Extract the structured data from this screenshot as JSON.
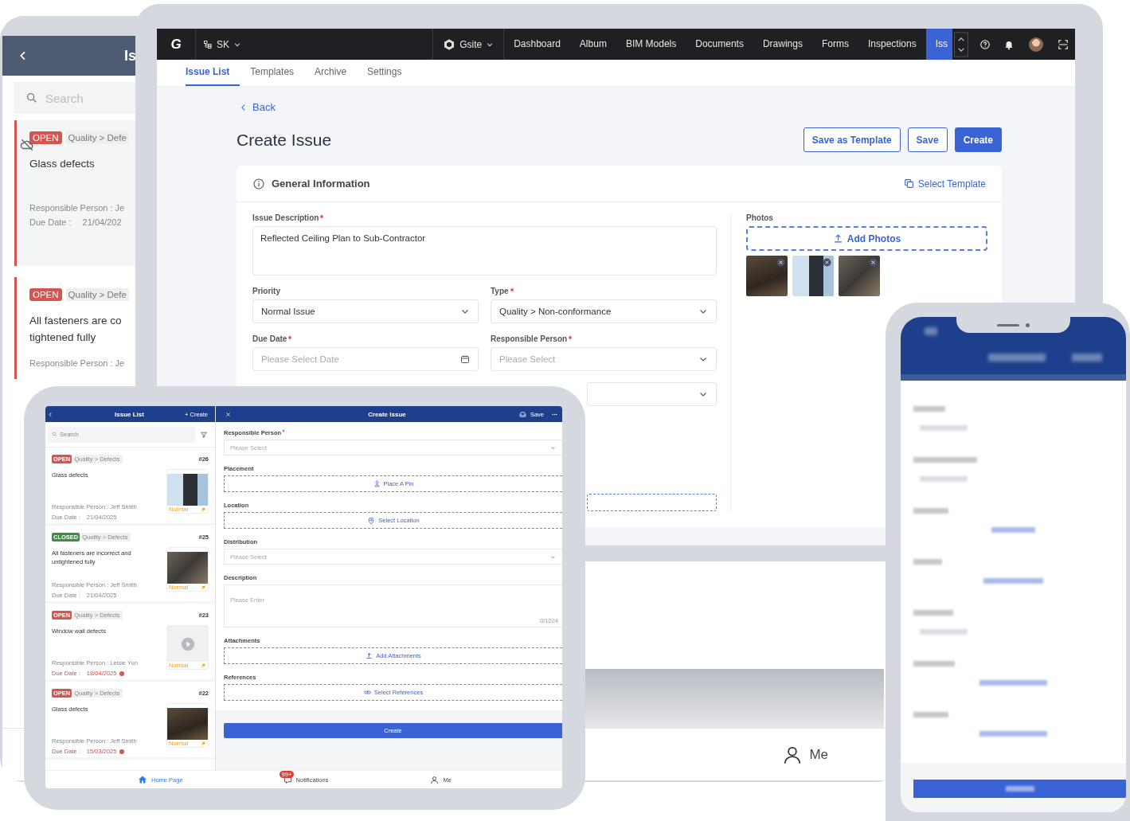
{
  "back_tablet": {
    "title": "Is",
    "search": {
      "placeholder": "Search"
    },
    "issues": [
      {
        "status": "OPEN",
        "color": "#d9534f",
        "category": "Quality > Defe",
        "title": "Glass defects",
        "offline": true,
        "responsible": "Responsible Person : Je",
        "due_label": "Due Date :",
        "due_date": "21/04/202"
      },
      {
        "status": "OPEN",
        "color": "#d9534f",
        "category": "Quality > Defe",
        "title": "All fasteners are co\ntightened fully",
        "offline": false,
        "responsible": "Responsible Person : Je"
      }
    ],
    "tab_bar": [
      {
        "label": "Me"
      }
    ]
  },
  "desktop": {
    "logo": "G",
    "org": "SK",
    "project": "Gsite",
    "nav": [
      {
        "label": "Dashboard",
        "selected": false
      },
      {
        "label": "Album",
        "selected": false
      },
      {
        "label": "BIM Models",
        "selected": false
      },
      {
        "label": "Documents",
        "selected": false
      },
      {
        "label": "Drawings",
        "selected": false
      },
      {
        "label": "Forms",
        "selected": false
      },
      {
        "label": "Inspections",
        "selected": false
      },
      {
        "label": "Iss",
        "selected": true
      }
    ],
    "tabs": [
      {
        "label": "Issue List",
        "selected": true
      },
      {
        "label": "Templates",
        "selected": false
      },
      {
        "label": "Archive",
        "selected": false
      },
      {
        "label": "Settings",
        "selected": false
      }
    ],
    "back": "Back",
    "heading": "Create Issue",
    "actions": [
      {
        "label": "Save as Template",
        "kind": "outline"
      },
      {
        "label": "Save",
        "kind": "outline"
      },
      {
        "label": "Create",
        "kind": "primary"
      }
    ],
    "section_title": "General Information",
    "select_template": "Select Template",
    "fields": [
      {
        "kind": "textarea",
        "label": "Issue Description",
        "required": true,
        "value": "Reflected Ceiling Plan to Sub-Contractor",
        "wide": true
      },
      {
        "kind": "select",
        "label": "Priority",
        "required": false,
        "value": "Normal Issue"
      },
      {
        "kind": "select",
        "label": "Type",
        "required": true,
        "value": "Quality > Non-conformance"
      },
      {
        "kind": "date",
        "label": "Due Date",
        "required": true,
        "placeholder": "Please Select Date"
      },
      {
        "kind": "select",
        "label": "Responsible Person",
        "required": true,
        "placeholder": "Please Select"
      },
      {
        "kind": "select"
      },
      {
        "kind": "dashed"
      }
    ],
    "photos": {
      "label": "Photos",
      "add": "Add Photos",
      "items": [
        {
          "kind": "photo"
        },
        {
          "kind": "photo"
        },
        {
          "kind": "photo"
        }
      ]
    }
  },
  "tablet": {
    "list": {
      "title": "Issue List",
      "create": "+ Create",
      "search": {
        "placeholder": "Search"
      },
      "issues": [
        {
          "status": "OPEN",
          "color": "#d9534f",
          "category": "Quality > Defects",
          "number": "#26",
          "title": "Glass defects",
          "responsible": "Responsible Person : Jeff Smith",
          "due_label": "Due Date :",
          "due_date": "21/04/2025",
          "overdue": false,
          "priority": "Normal",
          "kind": "photo"
        },
        {
          "status": "CLOSED",
          "color": "#3e8e41",
          "category": "Quality > Defects",
          "number": "#25",
          "title": "All fasteners are incorrect and untightened fully",
          "responsible": "Responsible Person : Jeff Smith",
          "due_label": "Due Date :",
          "due_date": "21/04/2025",
          "overdue": false,
          "priority": "Normal",
          "kind": "photo"
        },
        {
          "status": "OPEN",
          "color": "#d9534f",
          "category": "Quality > Defects",
          "number": "#23",
          "title": "Window wall defects",
          "responsible": "Responsible Person : Leisie Yun",
          "due_label": "Due Date :",
          "due_date": "18/04/2025",
          "overdue": true,
          "priority": "Normal",
          "kind": "video"
        },
        {
          "status": "OPEN",
          "color": "#d9534f",
          "category": "Quality > Defects",
          "number": "#22",
          "title": "Glass defects",
          "responsible": "Responsible Person : Jeff Smith",
          "due_label": "Due Date :",
          "due_date": "15/03/2025",
          "overdue": true,
          "priority": "Normal",
          "kind": "photo"
        }
      ]
    },
    "form": {
      "title": "Create Issue",
      "save": "Save",
      "fields": [
        {
          "kind": "select",
          "label": "Responsible Person",
          "required": true,
          "placeholder": "Please Select"
        },
        {
          "kind": "action",
          "label": "Placement",
          "required": false,
          "action": "Place A Pin"
        },
        {
          "kind": "action",
          "label": "Location",
          "required": false,
          "action": "Select Location"
        },
        {
          "kind": "select",
          "label": "Distribution",
          "required": false,
          "placeholder": "Please Select"
        },
        {
          "kind": "textarea",
          "label": "Description",
          "required": false,
          "placeholder": "Please Enter",
          "counter": "0/1024"
        },
        {
          "kind": "action",
          "label": "Attachments",
          "required": false,
          "action": "Add Attachments"
        },
        {
          "kind": "action",
          "label": "References",
          "required": false,
          "action": "Select References"
        }
      ],
      "submit": "Create"
    },
    "tab_bar": [
      {
        "label": "Home Page",
        "selected": true
      },
      {
        "label": "Notifications",
        "selected": false,
        "badge": "99+"
      },
      {
        "label": "Me",
        "selected": false
      }
    ]
  }
}
